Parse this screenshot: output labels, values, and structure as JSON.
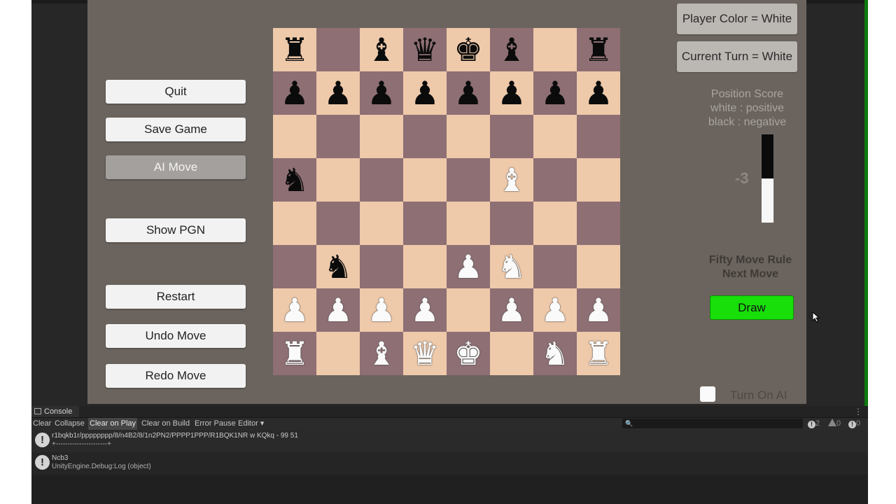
{
  "left_buttons": {
    "quit": "Quit",
    "save_game": "Save Game",
    "ai_move": "AI Move",
    "show_pgn": "Show PGN",
    "restart": "Restart",
    "undo_move": "Undo Move",
    "redo_move": "Redo Move"
  },
  "right_panel": {
    "player_color": "Player Color = White",
    "current_turn": "Current Turn = White",
    "score_title": "Position Score",
    "score_white": "white : positive",
    "score_black": "black : negative",
    "score_value": "-3",
    "score_black_fraction": 0.5,
    "fifty_line1": "Fifty Move Rule",
    "fifty_line2": "Next Move",
    "draw_label": "Draw",
    "ai_toggle_label": "Turn On AI"
  },
  "board": {
    "rows": [
      [
        "r",
        "",
        "b",
        "q",
        "k",
        "b",
        "",
        "r"
      ],
      [
        "p",
        "p",
        "p",
        "p",
        "p",
        "p",
        "p",
        "p"
      ],
      [
        "",
        "",
        "",
        "",
        "",
        "",
        "",
        ""
      ],
      [
        "n",
        "",
        "",
        "",
        "",
        "B",
        "",
        ""
      ],
      [
        "",
        "",
        "",
        "",
        "",
        "",
        "",
        ""
      ],
      [
        "",
        "n",
        "",
        "",
        "P",
        "N",
        "",
        ""
      ],
      [
        "P",
        "P",
        "P",
        "P",
        "",
        "P",
        "P",
        "P"
      ],
      [
        "R",
        "",
        "B",
        "Q",
        "K",
        "",
        "N",
        "R"
      ]
    ]
  },
  "console": {
    "tab_label": "Console",
    "toolbar": {
      "clear": "Clear",
      "collapse": "Collapse",
      "clear_on_play": "Clear on Play",
      "clear_on_build": "Clear on Build",
      "error_pause": "Error Pause",
      "editor": "Editor ▾"
    },
    "counts": {
      "info": "2",
      "warn": "0",
      "error": "0"
    },
    "logs": [
      {
        "line1": "r1bqkb1r/pppppppp/8/n4B2/8/1n2PN2/PPPP1PPP/R1BQK1NR w KQkq - 99 51",
        "line2": "+----------------------+"
      },
      {
        "line1": "Ncb3",
        "line2": "UnityEngine.Debug:Log (object)"
      }
    ]
  }
}
